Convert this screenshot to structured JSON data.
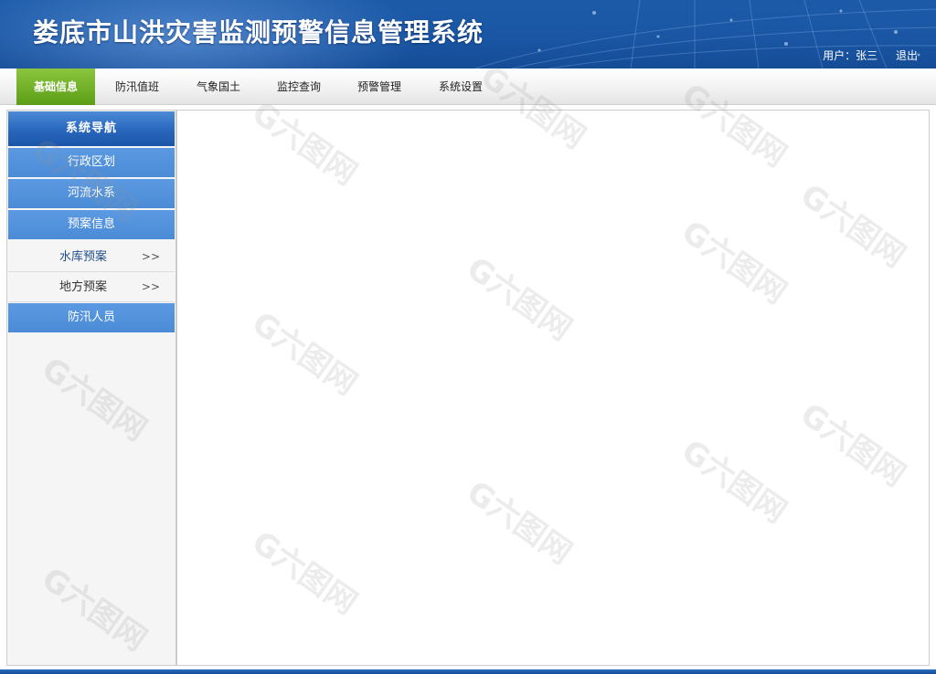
{
  "header": {
    "app_title": "娄底市山洪灾害监测预警信息管理系统",
    "user_label": "用户：张三",
    "logout_label": "退出"
  },
  "topnav": {
    "tabs": [
      {
        "label": "基础信息",
        "active": true
      },
      {
        "label": "防汛值班",
        "active": false
      },
      {
        "label": "气象国土",
        "active": false
      },
      {
        "label": "监控查询",
        "active": false
      },
      {
        "label": "预警管理",
        "active": false
      },
      {
        "label": "系统设置",
        "active": false
      }
    ]
  },
  "sidebar": {
    "title": "系统导航",
    "items": [
      {
        "label": "行政区划"
      },
      {
        "label": "河流水系"
      },
      {
        "label": "预案信息"
      },
      {
        "label": "水库预案",
        "chevron": ">>",
        "selected": true
      },
      {
        "label": "地方预案",
        "chevron": ">>"
      },
      {
        "label": "防汛人员"
      }
    ]
  },
  "watermark": "G六图网",
  "colors": {
    "header_blue": "#1a56a4",
    "active_tab_green": "#6aab22",
    "sidebar_item_blue": "#4b8bd6"
  }
}
